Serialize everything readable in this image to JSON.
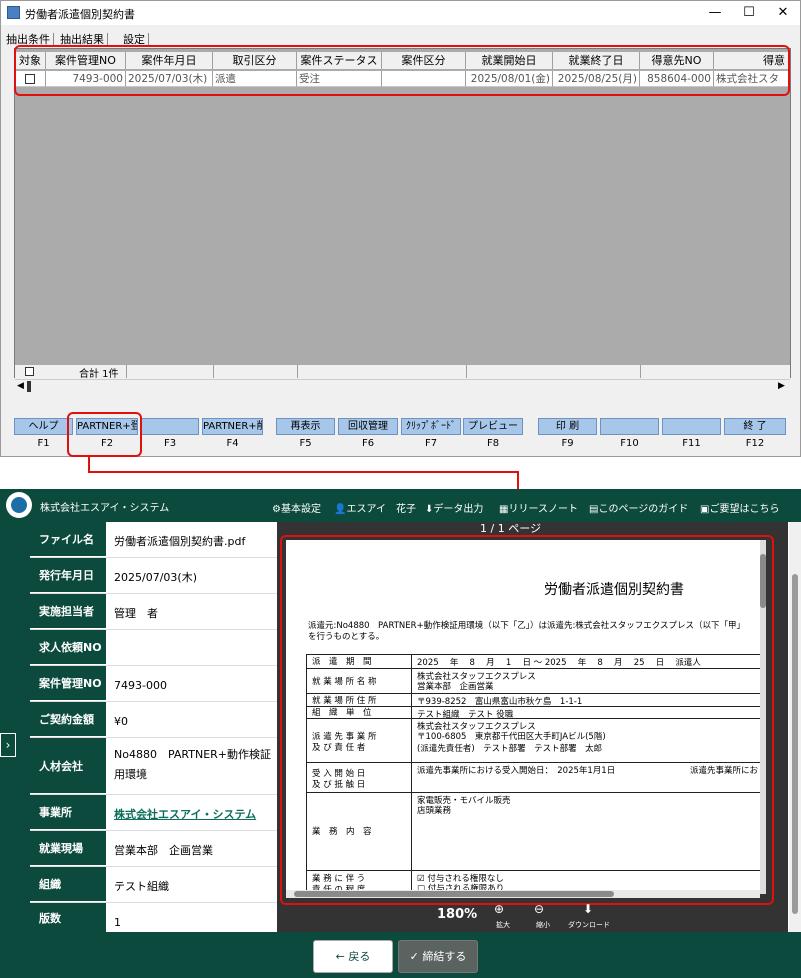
{
  "window": {
    "title": "労働者派遣個別契約書",
    "controls": [
      "—",
      "☐",
      "✕"
    ]
  },
  "tabs": [
    "抽出条件",
    "抽出結果",
    "設定"
  ],
  "grid": {
    "headers": [
      "対象",
      "案件管理NO",
      "案件年月日",
      "取引区分",
      "案件ステータス",
      "案件区分",
      "就業開始日",
      "就業終了日",
      "得意先NO",
      "得意"
    ],
    "row": [
      "",
      "7493-000",
      "2025/07/03(木)",
      "派遣",
      "受注",
      "",
      "2025/08/01(金)",
      "2025/08/25(月)",
      "858604-000",
      "株式会社スタ"
    ],
    "footer_total": "合計 1件"
  },
  "fkeys": [
    {
      "label": "ヘルプ",
      "key": "F1"
    },
    {
      "label": "PARTNER+登録",
      "key": "F2"
    },
    {
      "label": "",
      "key": "F3"
    },
    {
      "label": "PARTNER+削除",
      "key": "F4"
    },
    {
      "label": "再表示",
      "key": "F5"
    },
    {
      "label": "回収管理",
      "key": "F6"
    },
    {
      "label": "ｸﾘｯﾌﾟﾎﾞｰﾄﾞ",
      "key": "F7"
    },
    {
      "label": "プレビュー",
      "key": "F8"
    },
    {
      "label": "印 刷",
      "key": "F9"
    },
    {
      "label": "",
      "key": "F10"
    },
    {
      "label": "",
      "key": "F11"
    },
    {
      "label": "終 了",
      "key": "F12"
    }
  ],
  "web": {
    "company": "株式会社エスアイ・システム",
    "menu": {
      "settings": "基本設定",
      "user": "エスアイ　花子",
      "export": "データ出力",
      "release": "リリースノート",
      "guide": "このページのガイド",
      "request": "ご要望はこちら"
    },
    "fields": [
      {
        "label": "ファイル名",
        "value": "労働者派遣個別契約書.pdf"
      },
      {
        "label": "発行年月日",
        "value": "2025/07/03(木)"
      },
      {
        "label": "実施担当者",
        "value": "管理　者"
      },
      {
        "label": "求人依頼NO",
        "value": ""
      },
      {
        "label": "案件管理NO",
        "value": "7493-000"
      },
      {
        "label": "ご契約金額",
        "value": "¥0"
      },
      {
        "label": "人材会社",
        "value": "No4880　PARTNER+動作検証用環境"
      },
      {
        "label": "事業所",
        "value": "株式会社エスアイ・システム"
      },
      {
        "label": "就業現場",
        "value": "営業本部　企画営業"
      },
      {
        "label": "組織",
        "value": "テスト組織"
      },
      {
        "label": "版数",
        "value": "1"
      }
    ],
    "pdf": {
      "page_label": "1 / 1 ページ",
      "title": "労働者派遣個別契約書",
      "intro1": "派遣元:No4880　PARTNER+動作検証用環境（以下「乙」）は派遣先:株式会社スタッフエクスプレス（以下「甲」",
      "intro2": "を行うものとする。",
      "rows": [
        {
          "h": "派　遣　期　間",
          "v": "2025　 年　 8　 月　 1　 日 ～ 2025　 年　 8　 月　 25　 日　 派遣人"
        },
        {
          "h": "就 業 場 所 名 称",
          "v": "株式会社スタッフエクスプレス",
          "v2": "営業本部　企画営業"
        },
        {
          "h": "就 業 場 所 住 所",
          "v": "〒939-8252　富山県富山市秋ケ島　1-1-1"
        },
        {
          "h": "組　織　単　位",
          "v": "テスト組織　テスト 役職"
        },
        {
          "h": "派 遣 先 事 業 所",
          "h2": "及 び 責 任 者",
          "v": "株式会社スタッフエクスプレス",
          "v2": "〒100-6805　東京都千代田区大手町JAビル(5階)",
          "v3": "(派遣先責任者)　テスト部署　テスト部署　太郎"
        },
        {
          "h": "受 入 開 始 日",
          "h2": "及 び 抵 触 日",
          "v": "派遣先事業所における受入開始日：　2025年1月1日",
          "v2": "派遣先事業所にお"
        },
        {
          "h": "業　務　内　容",
          "v": "家電販売・モバイル販売",
          "v2": "店頭業務"
        },
        {
          "h": "業 務 に 伴 う",
          "h2": "責 任 の 程 度",
          "v": "☑ 付与される権限なし",
          "v2": "□ 付与される権限あり"
        }
      ],
      "zoom": "180%",
      "zoom_in": "拡大",
      "zoom_out": "縮小",
      "download": "ダウンロード"
    },
    "buttons": {
      "back": "戻る",
      "conclude": "締結する"
    }
  },
  "colors": {
    "accent": "#0c4a3e",
    "highlight": "#e01010",
    "fkey": "#a7c7ea"
  }
}
